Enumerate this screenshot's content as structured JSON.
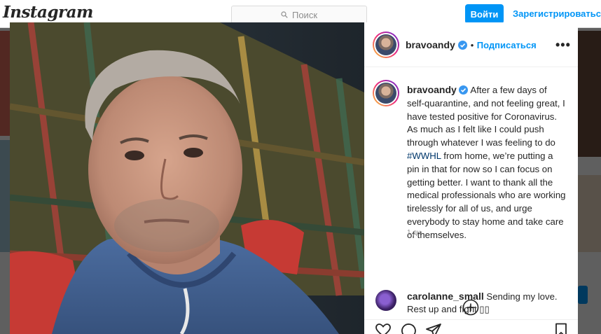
{
  "topbar": {
    "logo": "Instagram",
    "search_placeholder": "Поиск",
    "login_label": "Войти",
    "signup_label": "Зарегистрироваться"
  },
  "post": {
    "username": "bravoandy",
    "separator": "•",
    "follow_label": "Подписаться",
    "more_label": "•••",
    "caption_user": "bravoandy",
    "caption_part1": "After a few days of self-quarantine, and not feeling great, I have tested positive for Coronavirus.  As much as I felt like I could push through whatever I was feeling to do",
    "hashtag": "#WWHL",
    "caption_part2": "from home, we’re putting a pin in that for now so I can focus on getting better.  I want to thank all the medical professionals who are working tirelessly for all of us, and urge everybody to stay home and take care of themselves.",
    "age": "1 дн.",
    "comment_user": "carolanne_small",
    "comment_text": "Sending my love. Rest up and fight ▯▯"
  },
  "colors": {
    "accent": "#0095f6",
    "hashtag": "#00376b",
    "verified": "#3897f0"
  },
  "icons": [
    "search-icon",
    "verified-icon",
    "more-icon",
    "add-comment-icon",
    "like-icon",
    "comment-icon",
    "share-icon",
    "save-icon"
  ]
}
